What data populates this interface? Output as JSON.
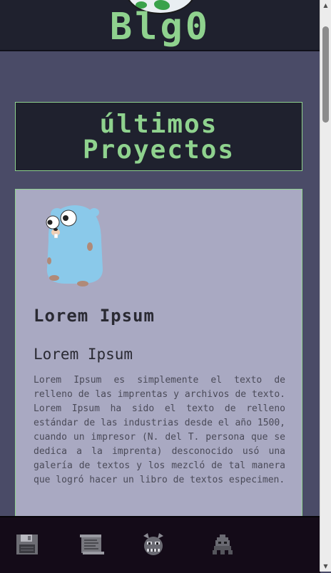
{
  "header": {
    "site_title": "Blg0"
  },
  "section": {
    "title": "últimos Proyectos"
  },
  "project_card": {
    "title": "Lorem Ipsum",
    "subtitle": "Lorem Ipsum",
    "description": "Lorem Ipsum es simplemente el texto de relleno de las imprentas y archivos de texto. Lorem Ipsum ha sido el texto de relleno estándar de las industrias desde el año 1500, cuando un impresor (N. del T. persona que se dedica a la imprenta) desconocido usó una galería de textos y los mezcló de tal manera que logró hacer un libro de textos especimen.",
    "image_icon": "gopher-mascot-icon"
  },
  "bottom_nav": {
    "items": [
      {
        "icon": "floppy-disk-icon"
      },
      {
        "icon": "scroll-document-icon"
      },
      {
        "icon": "angry-face-icon"
      },
      {
        "icon": "space-invader-icon"
      }
    ]
  },
  "colors": {
    "accent_green": "#8fd28e",
    "page_background": "#4a4b67",
    "dark_panel": "#1f212e",
    "card_background": "#a9a9c2",
    "nav_background": "#140b18"
  }
}
